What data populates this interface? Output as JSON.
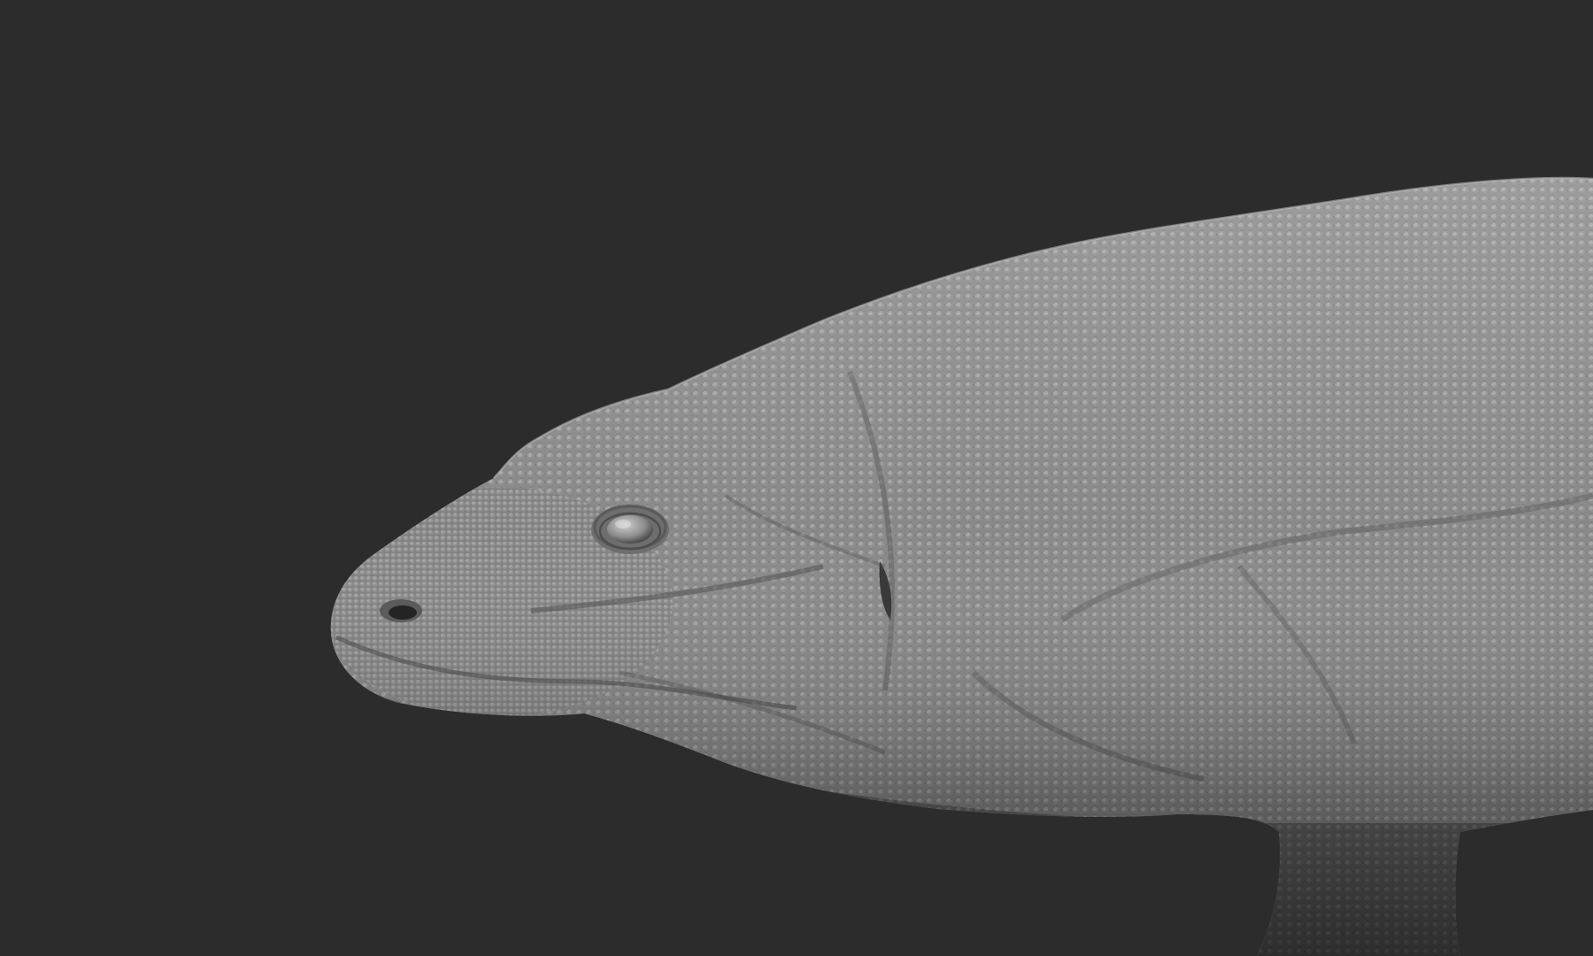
{
  "viewport": {
    "background_color": "#2c2c2d",
    "model": {
      "subject": "komodo-dragon-sculpt",
      "material_color": "#8a8a8a",
      "shading": "matcap-gray"
    }
  }
}
